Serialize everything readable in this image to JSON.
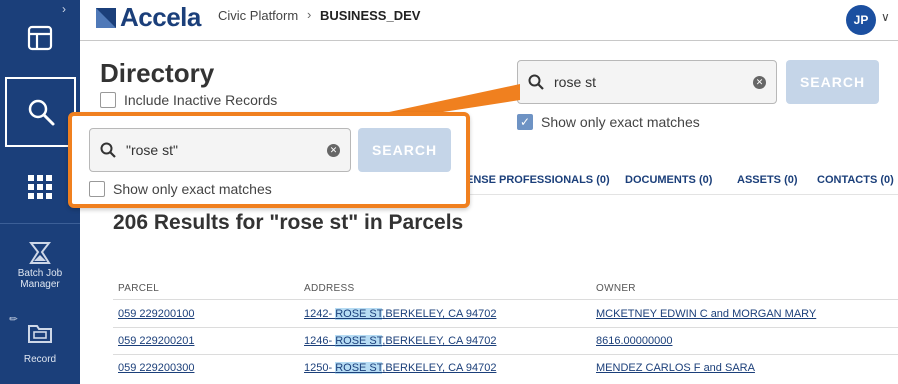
{
  "sidebar": {
    "items": [
      {
        "label": "",
        "icon": "dashboard-icon"
      },
      {
        "label": "",
        "icon": "search-icon"
      },
      {
        "label": "",
        "icon": "apps-grid-icon"
      },
      {
        "label": "Batch Job Manager",
        "icon": "batch-job-icon"
      },
      {
        "label": "Record",
        "icon": "record-folder-icon"
      }
    ]
  },
  "header": {
    "brand": "Accela",
    "breadcrumb": [
      "Civic Platform",
      "BUSINESS_DEV"
    ],
    "avatar_initials": "JP"
  },
  "page": {
    "title": "Directory",
    "include_inactive_label": "Include Inactive Records"
  },
  "search": {
    "value": "rose st",
    "button_label": "SEARCH",
    "exact_match_label": "Show only exact matches",
    "exact_match_checked": true
  },
  "callout": {
    "value": "\"rose st\"",
    "button_label": "SEARCH",
    "exact_match_label": "Show only exact matches",
    "exact_match_checked": false
  },
  "tabs": [
    {
      "label": "ENSE PROFESSIONALS (0)"
    },
    {
      "label": "DOCUMENTS (0)"
    },
    {
      "label": "ASSETS (0)"
    },
    {
      "label": "CONTACTS (0)"
    }
  ],
  "results_heading": "206 Results for \"rose st\" in Parcels",
  "table": {
    "columns": [
      "PARCEL",
      "ADDRESS",
      "OWNER"
    ],
    "rows": [
      {
        "parcel": "059 229200100",
        "addr_pre": "1242- ",
        "addr_hl": "ROSE ST",
        "addr_post": ",BERKELEY, CA 94702",
        "owner": "MCKETNEY EDWIN C and MORGAN MARY"
      },
      {
        "parcel": "059 229200201",
        "addr_pre": "1246- ",
        "addr_hl": "ROSE ST",
        "addr_post": ",BERKELEY, CA 94702",
        "owner": "8616.00000000"
      },
      {
        "parcel": "059 229200300",
        "addr_pre": "1250- ",
        "addr_hl": "ROSE ST",
        "addr_post": ",BERKELEY, CA 94702",
        "owner": "MENDEZ CARLOS F and SARA"
      }
    ]
  },
  "colors": {
    "sidebar": "#1b3f7a",
    "accent": "#f0801f",
    "link": "#1b3f7a",
    "highlight": "#b6dcf4"
  }
}
